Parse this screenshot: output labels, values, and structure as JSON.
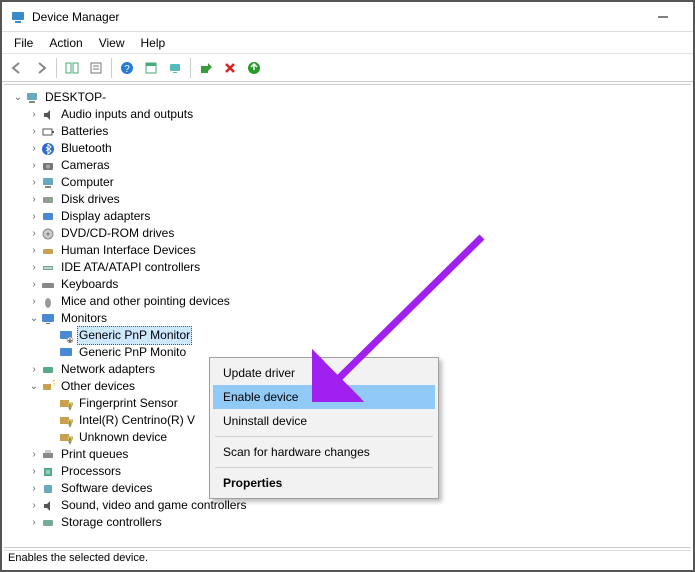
{
  "window": {
    "title": "Device Manager"
  },
  "menu": {
    "file": "File",
    "action": "Action",
    "view": "View",
    "help": "Help"
  },
  "tree": {
    "root": "DESKTOP-",
    "items": [
      "Audio inputs and outputs",
      "Batteries",
      "Bluetooth",
      "Cameras",
      "Computer",
      "Disk drives",
      "Display adapters",
      "DVD/CD-ROM drives",
      "Human Interface Devices",
      "IDE ATA/ATAPI controllers",
      "Keyboards",
      "Mice and other pointing devices"
    ],
    "monitors": {
      "label": "Monitors",
      "child1": "Generic PnP Monitor",
      "child2": "Generic PnP Monito"
    },
    "network": "Network adapters",
    "other": {
      "label": "Other devices",
      "c1": "Fingerprint Sensor",
      "c2": "Intel(R) Centrino(R) V",
      "c3": "Unknown device"
    },
    "tail": [
      "Print queues",
      "Processors",
      "Software devices",
      "Sound, video and game controllers",
      "Storage controllers"
    ]
  },
  "context": {
    "update": "Update driver",
    "enable": "Enable device",
    "uninstall": "Uninstall device",
    "scan": "Scan for hardware changes",
    "props": "Properties"
  },
  "status": "Enables the selected device."
}
